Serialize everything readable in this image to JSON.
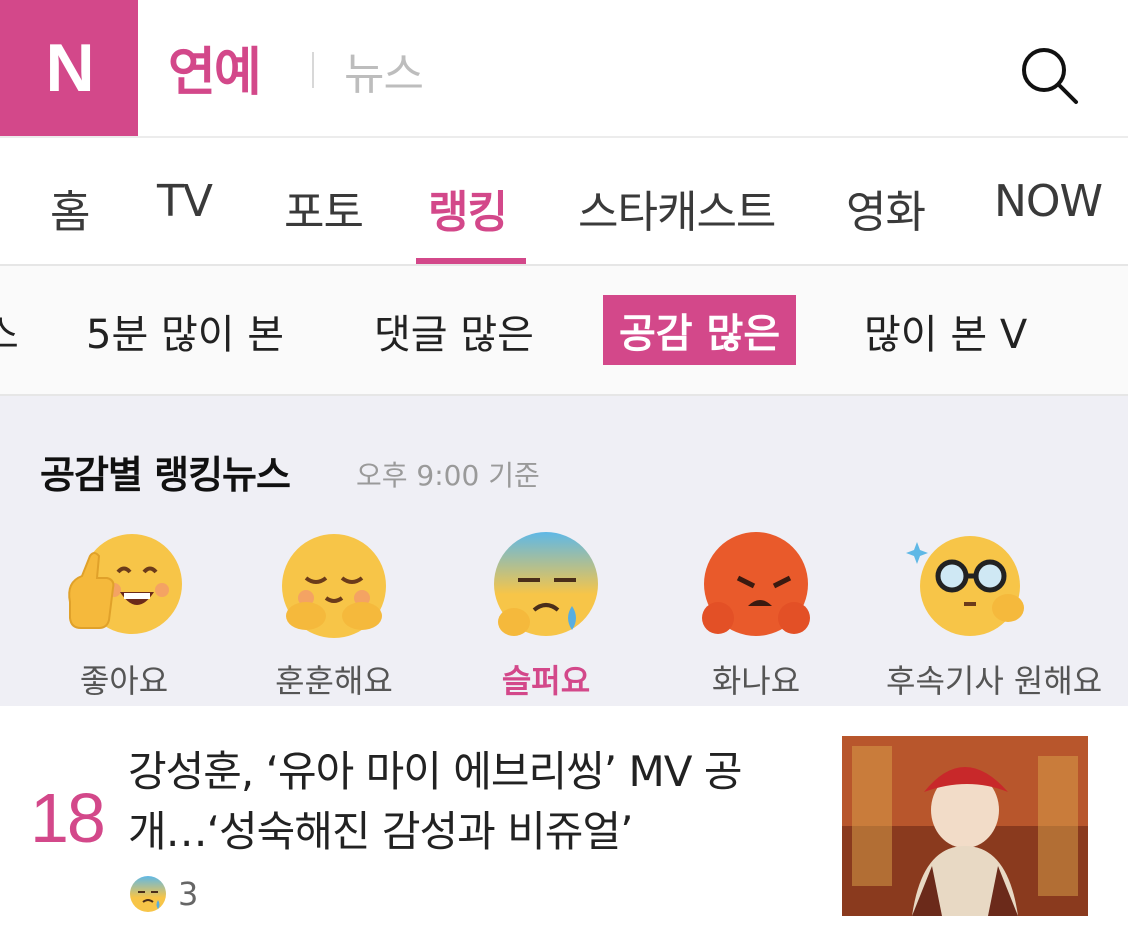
{
  "header": {
    "logo": "N",
    "section_title": "연예",
    "section_sub": "뉴스",
    "search_icon": "search-icon"
  },
  "main_tabs": [
    {
      "label": "홈",
      "active": false
    },
    {
      "label": "TV",
      "active": false
    },
    {
      "label": "포토",
      "active": false
    },
    {
      "label": "랭킹",
      "active": true
    },
    {
      "label": "스타캐스트",
      "active": false
    },
    {
      "label": "영화",
      "active": false
    },
    {
      "label": "NOW",
      "active": false
    }
  ],
  "sub_tabs": [
    {
      "label": "스",
      "active": false
    },
    {
      "label": "5분 많이 본",
      "active": false
    },
    {
      "label": "댓글 많은",
      "active": false
    },
    {
      "label": "공감 많은",
      "active": true
    },
    {
      "label": "많이 본 V",
      "active": false
    }
  ],
  "ranking": {
    "title": "공감별 랭킹뉴스",
    "time": "오후 9:00 기준"
  },
  "reactions": [
    {
      "label": "좋아요",
      "icon": "thumbs-up-face-icon",
      "active": false
    },
    {
      "label": "훈훈해요",
      "icon": "warm-face-icon",
      "active": false
    },
    {
      "label": "슬퍼요",
      "icon": "sad-face-icon",
      "active": true
    },
    {
      "label": "화나요",
      "icon": "angry-face-icon",
      "active": false
    },
    {
      "label": "후속기사 원해요",
      "icon": "glasses-face-icon",
      "active": false
    }
  ],
  "article": {
    "rank": "18",
    "title": "강성훈, ‘유아 마이 에브리씽’ MV 공개…‘성숙해진 감성과 비쥬얼’",
    "reaction_icon": "sad-face-icon",
    "reaction_count": "3"
  },
  "colors": {
    "accent": "#d3488a",
    "section_bg": "#efeff5"
  }
}
